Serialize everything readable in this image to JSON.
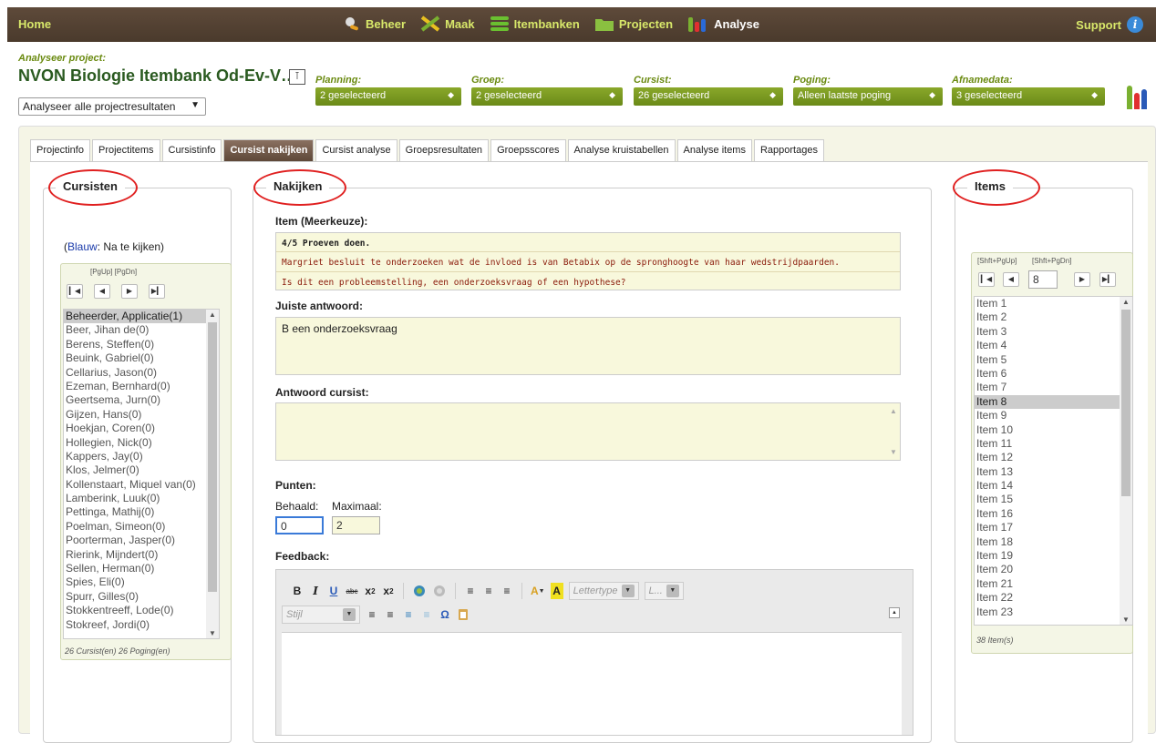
{
  "topbar": {
    "home": "Home",
    "nav": [
      {
        "label": "Beheer",
        "icon": "wrench-icon"
      },
      {
        "label": "Maak",
        "icon": "tools-icon"
      },
      {
        "label": "Itembanken",
        "icon": "database-icon"
      },
      {
        "label": "Projecten",
        "icon": "folder-icon"
      },
      {
        "label": "Analyse",
        "icon": "bar-chart-icon"
      }
    ],
    "support": "Support",
    "accent": "#d8e86a"
  },
  "header": {
    "project_label": "Analyseer project:",
    "project_title": "NVON Biologie Itembank Od-Ev-V…",
    "analyse_select": "Analyseer alle projectresultaten",
    "filters": [
      {
        "label": "Planning:",
        "value": "2 geselecteerd"
      },
      {
        "label": "Groep:",
        "value": "2 geselecteerd"
      },
      {
        "label": "Cursist:",
        "value": "26 geselecteerd"
      },
      {
        "label": "Poging:",
        "value": "Alleen laatste poging"
      },
      {
        "label": "Afnamedata:",
        "value": "3 geselecteerd"
      }
    ]
  },
  "tabs": [
    "Projectinfo",
    "Projectitems",
    "Cursistinfo",
    "Cursist nakijken",
    "Cursist analyse",
    "Groepsresultaten",
    "Groepsscores",
    "Analyse kruistabellen",
    "Analyse items",
    "Rapportages"
  ],
  "cursisten": {
    "title": "Cursisten",
    "legend_blue": "Blauw",
    "legend_rest": ": Na te kijken)",
    "legend_open": "(",
    "pager_hint": "[PgUp] [PgDn]",
    "list": [
      "Beheerder, Applicatie(1)",
      "Beer, Jihan de(0)",
      "Berens, Steffen(0)",
      "Beuink, Gabriel(0)",
      "Cellarius, Jason(0)",
      "Ezeman, Bernhard(0)",
      "Geertsema, Jurn(0)",
      "Gijzen, Hans(0)",
      "Hoekjan, Coren(0)",
      "Hollegien, Nick(0)",
      "Kappers, Jay(0)",
      "Klos, Jelmer(0)",
      "Kollenstaart, Miquel van(0)",
      "Lamberink, Luuk(0)",
      "Pettinga, Mathij(0)",
      "Poelman, Simeon(0)",
      "Poorterman, Jasper(0)",
      "Rierink, Mijndert(0)",
      "Sellen, Herman(0)",
      "Spies, Eli(0)",
      "Spurr, Gilles(0)",
      "Stokkentreeff, Lode(0)",
      "Stokreef, Jordi(0)"
    ],
    "selected_index": 0,
    "count": "26 Cursist(en) 26 Poging(en)"
  },
  "nakijken": {
    "title": "Nakijken",
    "item_label": "Item (Meerkeuze):",
    "item_header": "4/5 Proeven doen.",
    "item_line1": "Margriet besluit te onderzoeken wat de invloed is van Betabix op de spronghoogte van haar wedstrijdpaarden.",
    "item_line2": "Is dit een probleemstelling, een onderzoeksvraag of een hypothese?",
    "correct_label": "Juiste antwoord:",
    "correct_value": "B een onderzoeksvraag",
    "student_label": "Antwoord cursist:",
    "points_label": "Punten:",
    "achieved_label": "Behaald:",
    "max_label": "Maximaal:",
    "achieved_value": "0",
    "max_value": "2",
    "feedback_label": "Feedback:",
    "editor": {
      "font_placeholder": "Lettertype",
      "size_placeholder": "L...",
      "style_placeholder": "Stijl"
    }
  },
  "items": {
    "title": "Items",
    "hint_prev": "[Shft+PgUp]",
    "hint_next": "[Shft+PgDn]",
    "current": "8",
    "list": [
      "Item 1",
      "Item 2",
      "Item 3",
      "Item 4",
      "Item 5",
      "Item 6",
      "Item 7",
      "Item 8",
      "Item 9",
      "Item 10",
      "Item 11",
      "Item 12",
      "Item 13",
      "Item 14",
      "Item 15",
      "Item 16",
      "Item 17",
      "Item 18",
      "Item 19",
      "Item 20",
      "Item 21",
      "Item 22",
      "Item 23"
    ],
    "selected_index": 7,
    "count": "38 Item(s)"
  }
}
